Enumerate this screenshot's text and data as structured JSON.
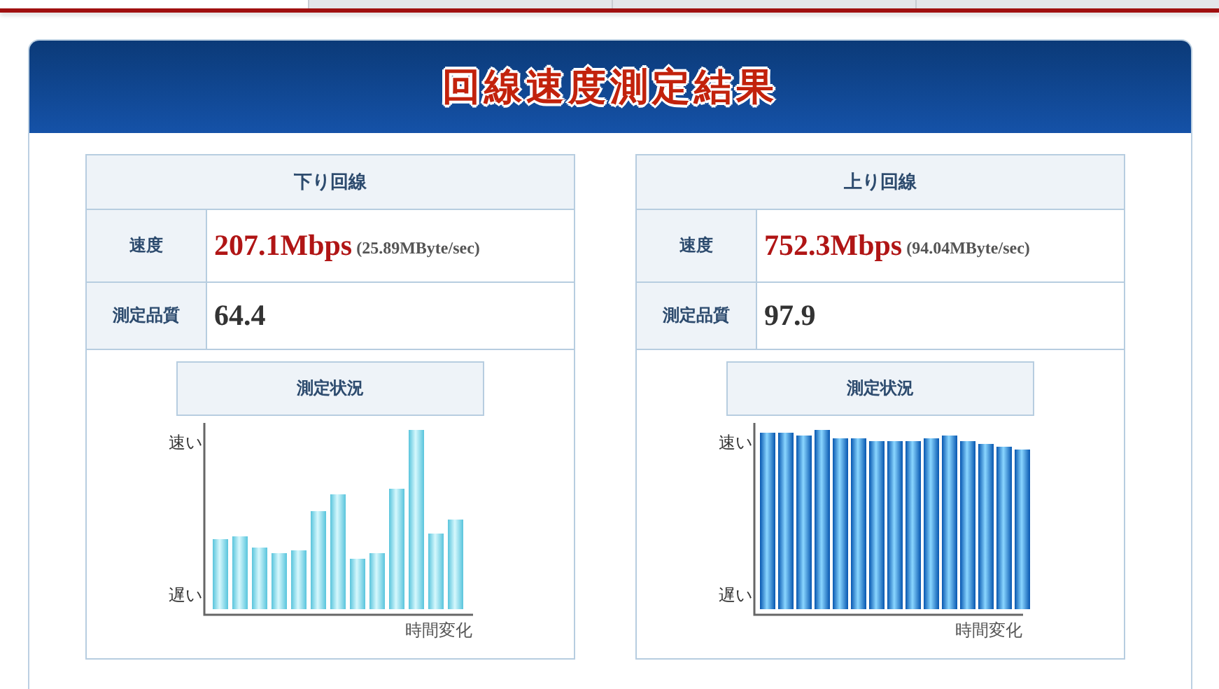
{
  "page_title": "回線速度測定結果",
  "results": [
    {
      "heading": "下り回線",
      "speed_label": "速度",
      "speed": "207.1Mbps",
      "speed_detail": "(25.89MByte/sec)",
      "quality_label": "測定品質",
      "quality": "64.4",
      "status_title": "測定状況",
      "graph": {
        "kind": "download",
        "fast_label": "速い",
        "slow_label": "遅い",
        "time_label": "時間変化"
      }
    },
    {
      "heading": "上り回線",
      "speed_label": "速度",
      "speed": "752.3Mbps",
      "speed_detail": "(94.04MByte/sec)",
      "quality_label": "測定品質",
      "quality": "97.9",
      "status_title": "測定状況",
      "graph": {
        "kind": "upload",
        "fast_label": "速い",
        "slow_label": "遅い",
        "time_label": "時間変化"
      }
    }
  ]
}
